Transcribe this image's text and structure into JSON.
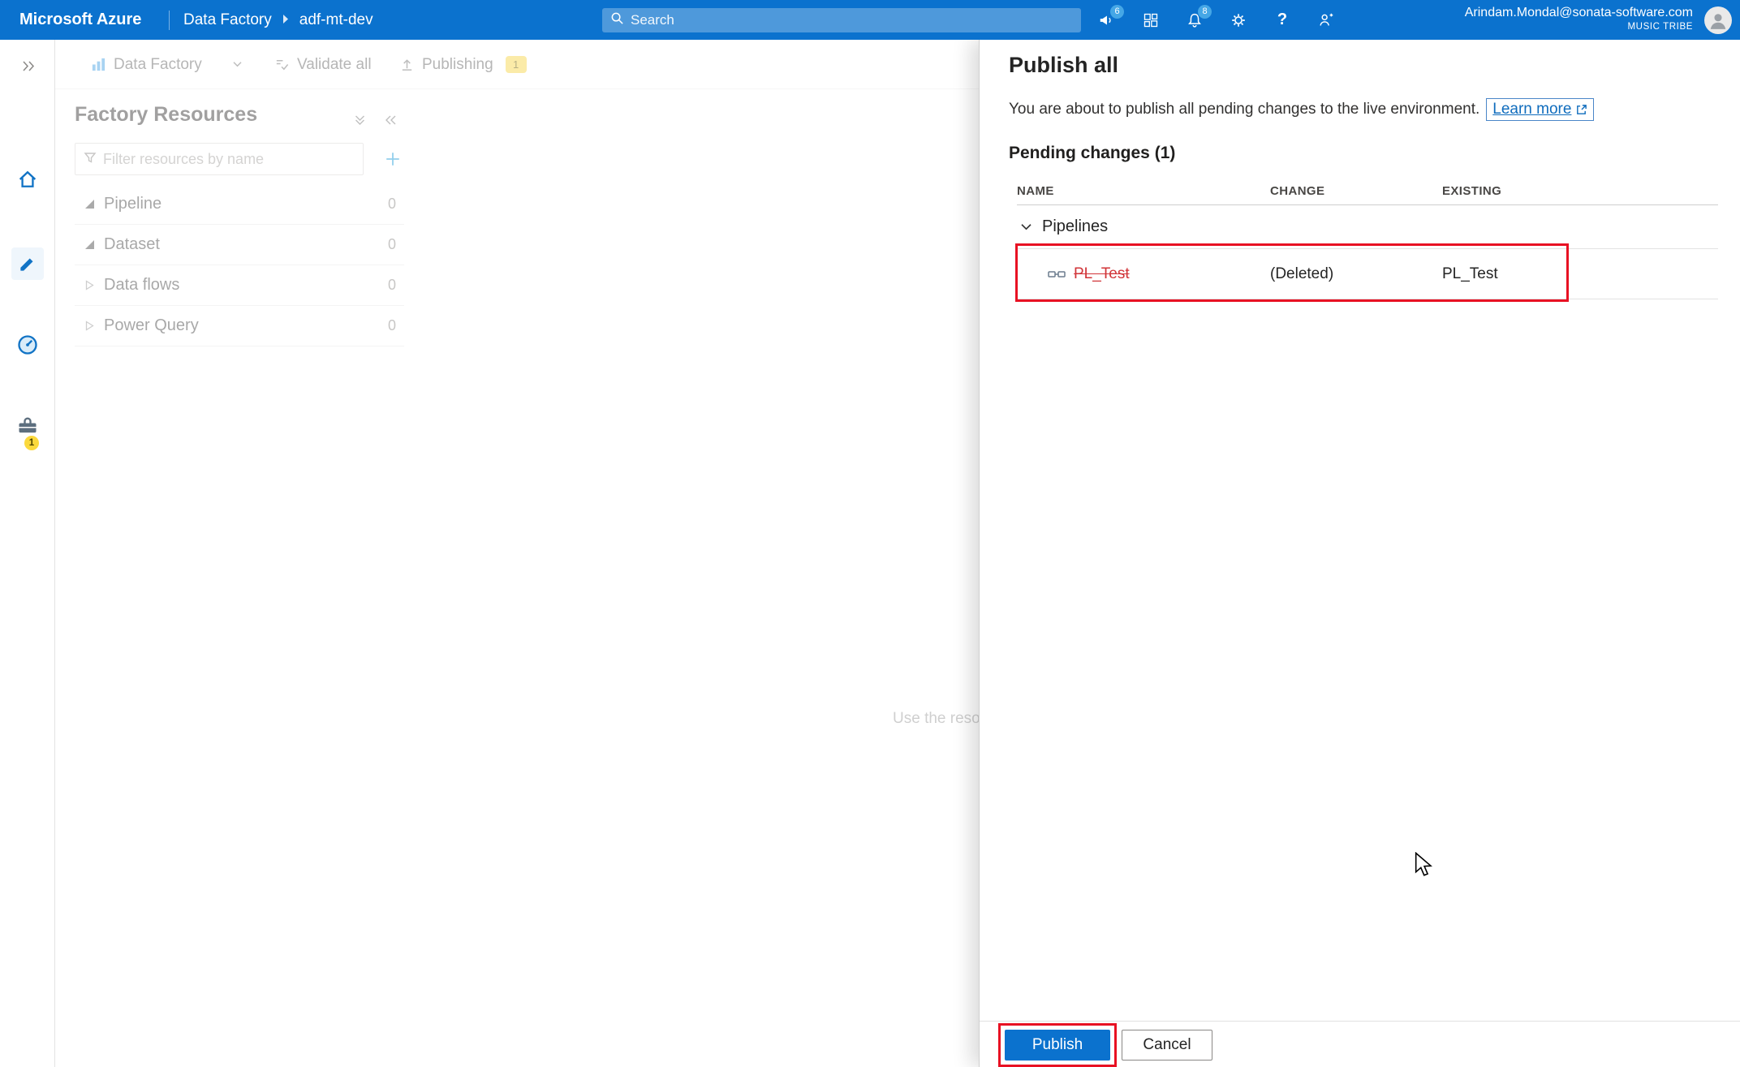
{
  "topbar": {
    "brand": "Microsoft Azure",
    "breadcrumb_root": "Data Factory",
    "breadcrumb_current": "adf-mt-dev",
    "search_placeholder": "Search",
    "help_glyph": "?",
    "badges": {
      "announcements": "6",
      "notifications": "8"
    },
    "user": {
      "email": "Arindam.Mondal@sonata-software.com",
      "org": "MUSIC TRIBE"
    }
  },
  "left_rail": {
    "manage_badge": "1"
  },
  "toolbar": {
    "data_factory": "Data Factory",
    "validate_all": "Validate all",
    "publishing": "Publishing",
    "publishing_badge": "1"
  },
  "factory_resources": {
    "title": "Factory Resources",
    "filter_placeholder": "Filter resources by name",
    "sections": [
      {
        "label": "Pipeline",
        "count": "0",
        "expanded": true
      },
      {
        "label": "Dataset",
        "count": "0",
        "expanded": true
      },
      {
        "label": "Data flows",
        "count": "0",
        "expanded": false
      },
      {
        "label": "Power Query",
        "count": "0",
        "expanded": false
      }
    ]
  },
  "canvas": {
    "hint": "Use the reso"
  },
  "publish_panel": {
    "title": "Publish all",
    "description": "You are about to publish all pending changes to the live environment.",
    "learn_more": "Learn more",
    "pending_title": "Pending changes (1)",
    "headers": {
      "name": "NAME",
      "change": "CHANGE",
      "existing": "EXISTING"
    },
    "group_label": "Pipelines",
    "row": {
      "name": "PL_Test",
      "change": "(Deleted)",
      "existing": "PL_Test"
    },
    "publish_label": "Publish",
    "cancel_label": "Cancel"
  },
  "colors": {
    "accent": "#0b72ce",
    "annotation_red": "#e81123",
    "deleted_text": "#d13438",
    "badge_yellow": "#fbd93d"
  }
}
